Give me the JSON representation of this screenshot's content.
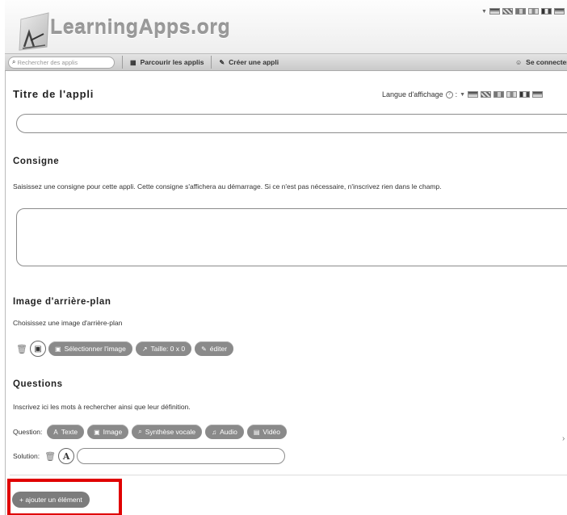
{
  "header": {
    "logo_text": "LearningApps.org",
    "search_placeholder": "Rechercher des applis",
    "nav": {
      "browse": "Parcourir les applis",
      "create": "Créer une appli",
      "login": "Se connecter"
    }
  },
  "form": {
    "title_heading": "Titre de l'appli",
    "language_label": "Langue d'affichage",
    "language_help": "?",
    "language_colon": ":",
    "title_value": "",
    "consigne_heading": "Consigne",
    "consigne_help": "Saisissez une consigne pour cette appli. Cette consigne s'affichera au démarrage. Si ce n'est pas nécessaire, n'inscrivez rien dans le champ.",
    "consigne_value": "",
    "background_heading": "Image d'arrière-plan",
    "background_help": "Choisissez une image d'arrière-plan",
    "background_buttons": {
      "select": "Sélectionner l'image",
      "size": "Taille: 0 x 0",
      "edit": "éditer"
    },
    "questions_heading": "Questions",
    "questions_help": "Inscrivez ici les mots à rechercher ainsi que leur définition.",
    "question_label": "Question:",
    "question_types": {
      "text": "Texte",
      "image": "Image",
      "speech": "Synthèse vocale",
      "audio": "Audio",
      "video": "Vidéo"
    },
    "solution_label": "Solution:",
    "solution_value": "",
    "add_element": "+ ajouter un élément"
  },
  "icons": {
    "search": "search-icon",
    "grid": "grid-icon",
    "pencil": "pencil-icon",
    "user": "user-icon",
    "trash": "trash-icon",
    "image": "image-icon",
    "resize": "resize-icon",
    "edit": "edit-icon",
    "text": "text-icon",
    "speech": "speech-icon",
    "music": "music-icon",
    "film": "film-icon",
    "chevron": "chevron-right-icon"
  },
  "colors": {
    "highlight": "#e00000",
    "pill": "#8a8a8a"
  }
}
